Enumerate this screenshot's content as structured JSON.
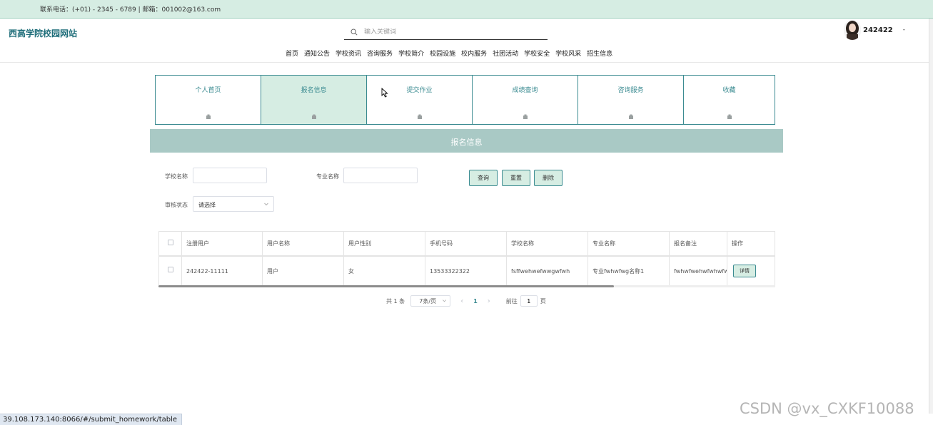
{
  "topbar": {
    "contact": "联系电话：(+01) - 2345 - 6789 | 邮箱：001002@163.com"
  },
  "header": {
    "site_title": "西高学院校园网站",
    "search_placeholder": "输入关键词",
    "username": "242422",
    "user_caret": "-"
  },
  "nav": [
    "首页",
    "通知公告",
    "学校资讯",
    "咨询服务",
    "学校简介",
    "校园设施",
    "校内服务",
    "社团活动",
    "学校安全",
    "学校风采",
    "招生信息"
  ],
  "tabs": [
    {
      "label": "个人首页"
    },
    {
      "label": "报名信息"
    },
    {
      "label": "提交作业"
    },
    {
      "label": "成绩查询"
    },
    {
      "label": "咨询服务"
    },
    {
      "label": "收藏"
    }
  ],
  "section_title": "报名信息",
  "filters": {
    "school_name_label": "学校名称",
    "major_name_label": "专业名称",
    "status_label": "审核状态",
    "status_value": "请选择",
    "query_button": "查询",
    "reset_button": "重置",
    "delete_button": "删除"
  },
  "table": {
    "headers": [
      "注册用户",
      "用户名称",
      "用户性别",
      "手机号码",
      "学校名称",
      "专业名称",
      "报名备注",
      "操作"
    ],
    "rows": [
      {
        "user": "242422-11111",
        "name": "用户",
        "gender": "女",
        "phone": "13533322322",
        "school": "fsffwehwefwwgwfwh",
        "major": "专业fwhwfwg名称1",
        "note": "fwhwfwehwfwhwfw",
        "action": "详情"
      }
    ]
  },
  "pager": {
    "total": "共 1 条",
    "page_size": "7条/页",
    "prev": "‹",
    "current": "1",
    "next": "›",
    "goto_label": "前往",
    "goto_value": "1",
    "page_suffix": "页"
  },
  "status_url": "39.108.173.140:8066/#/submit_homework/table",
  "watermark": "CSDN @vx_CXKF10088",
  "colors": {
    "accent": "#3b8b91",
    "light": "#d6ede3",
    "bar": "#a9c9c5"
  }
}
